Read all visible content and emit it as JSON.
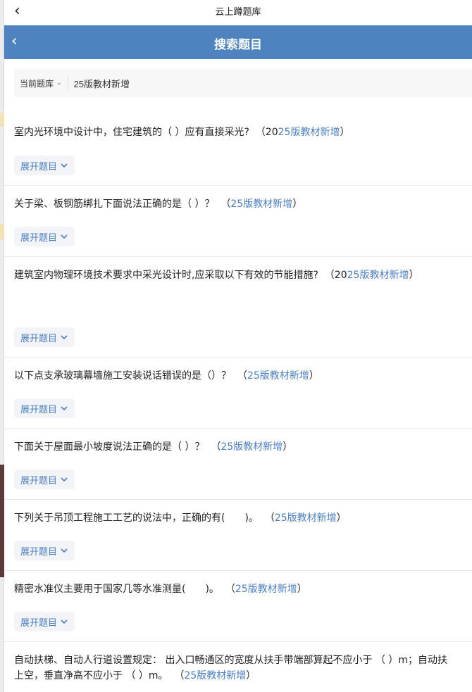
{
  "outer": {
    "title": "云上蹲题库"
  },
  "nav": {
    "title": "搜索题目"
  },
  "filter": {
    "scope_label": "当前题库",
    "keyword": "25版教材新增"
  },
  "expand_label": "展开题目",
  "questions": [
    {
      "text": "室内光环境中设计中，住宅建筑的（ ）应有直接采光?",
      "pre": "（20",
      "tag": "25版教材新增",
      "post": "）"
    },
    {
      "text": "关于梁、板钢筋绑扎下面说法正确的是（ ）？",
      "pre": "（",
      "tag": "25版教材新增",
      "post": "）"
    },
    {
      "text": " 建筑室内物理环境技术要求中采光设计时,应采取以下有效的节能措施?",
      "pre": "（20",
      "tag": "25版教材新增",
      "post": "）"
    },
    {
      "text": "以下点支承玻璃幕墙施工安装说话错误的是（）？",
      "pre": "（",
      "tag": "25版教材新增",
      "post": "）"
    },
    {
      "text": "下面关于屋面最小坡度说法正确的是（ ）？",
      "pre": "（",
      "tag": "25版教材新增",
      "post": "）"
    },
    {
      "text": "下列关于吊顶工程施工工艺的说法中，正确的有(　　)。",
      "pre": "（",
      "tag": "25版教材新增",
      "post": "）"
    },
    {
      "text": "精密水准仪主要用于国家几等水准测量(　　)。",
      "pre": "（",
      "tag": "25版教材新增",
      "post": "）"
    },
    {
      "text": "自动扶梯、自动人行道设置规定： 出入口畅通区的宽度从扶手带端部算起不应小于 （ ）m；自动扶",
      "line2": "上空，垂直净高不应小于 （ ）m。",
      "pre": "（",
      "tag": "25版教材新增",
      "post": "）"
    }
  ]
}
